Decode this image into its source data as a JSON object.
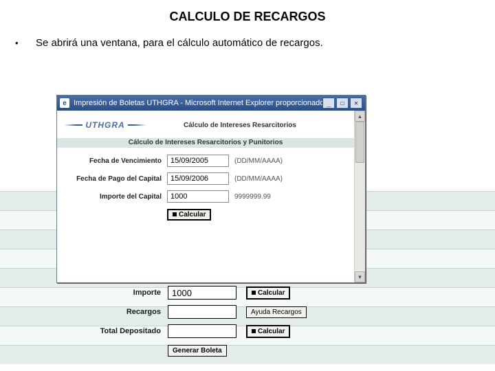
{
  "title": "CALCULO DE RECARGOS",
  "bullet": "Se abrirá una ventana, para el cálculo automático de recargos.",
  "window": {
    "title": "Impresión de Boletas UTHGRA - Microsoft Internet Explorer proporcionado p...",
    "appicon": "e",
    "logo_text": "UTHGRA",
    "header_small": "Cálculo de Intereses Resarcitorios",
    "band_title": "Cálculo de Intereses Resarcitorios y Punitorios",
    "fields": {
      "venc_label": "Fecha de Vencimiento",
      "venc_value": "15/09/2005",
      "venc_hint": "(DD/MM/AAAA)",
      "pago_label": "Fecha de Pago del Capital",
      "pago_value": "15/09/2006",
      "pago_hint": "(DD/MM/AAAA)",
      "cap_label": "Importe del Capital",
      "cap_value": "1000",
      "cap_hint": "9999999.99",
      "calc_label": "Calcular"
    }
  },
  "lower": {
    "importe_label": "Importe",
    "importe_value": "1000",
    "importe_btn": "Calcular",
    "recargos_label": "Recargos",
    "recargos_value": "",
    "recargos_btn": "Ayuda Recargos",
    "total_label": "Total Depositado",
    "total_value": "",
    "total_btn": "Calcular",
    "generar_btn": "Generar Boleta"
  }
}
